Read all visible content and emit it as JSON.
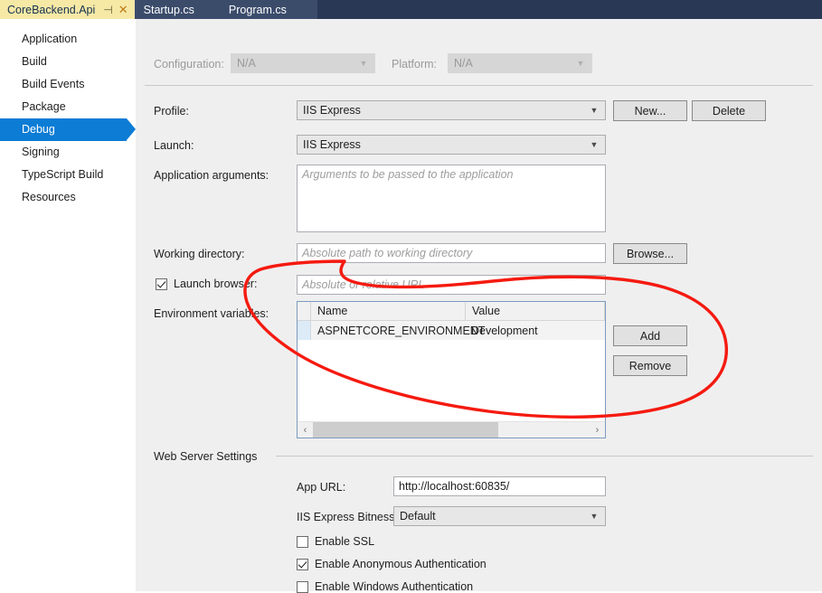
{
  "window": {
    "tabs": [
      {
        "label": "CoreBackend.Api",
        "active": true,
        "pin_icon": "pin-icon",
        "close_icon": "close-icon"
      },
      {
        "label": "Startup.cs",
        "active": false
      },
      {
        "label": "Program.cs",
        "active": false
      }
    ]
  },
  "sidebar": {
    "items": [
      {
        "label": "Application",
        "selected": false
      },
      {
        "label": "Build",
        "selected": false
      },
      {
        "label": "Build Events",
        "selected": false
      },
      {
        "label": "Package",
        "selected": false
      },
      {
        "label": "Debug",
        "selected": true
      },
      {
        "label": "Signing",
        "selected": false
      },
      {
        "label": "TypeScript Build",
        "selected": false
      },
      {
        "label": "Resources",
        "selected": false
      }
    ]
  },
  "config_row": {
    "configuration_label": "Configuration:",
    "configuration_value": "N/A",
    "platform_label": "Platform:",
    "platform_value": "N/A"
  },
  "debug": {
    "profile_label": "Profile:",
    "profile_value": "IIS Express",
    "new_button": "New...",
    "delete_button": "Delete",
    "launch_label": "Launch:",
    "launch_value": "IIS Express",
    "app_args_label": "Application arguments:",
    "app_args_placeholder": "Arguments to be passed to the application",
    "working_dir_label": "Working directory:",
    "working_dir_placeholder": "Absolute path to working directory",
    "browse_button": "Browse...",
    "launch_browser_label": "Launch browser:",
    "launch_browser_checked": true,
    "launch_browser_placeholder": "Absolute or relative URL",
    "env_vars_label": "Environment variables:",
    "env_grid": {
      "columns": [
        "Name",
        "Value"
      ],
      "rows": [
        {
          "name": "ASPNETCORE_ENVIRONMENT",
          "value": "Development"
        }
      ],
      "scroll_left_icon": "chevron-left-icon",
      "scroll_right_icon": "chevron-right-icon"
    },
    "add_button": "Add",
    "remove_button": "Remove"
  },
  "web_server": {
    "section_title": "Web Server Settings",
    "app_url_label": "App URL:",
    "app_url_value": "http://localhost:60835/",
    "bitness_label": "IIS Express Bitness:",
    "bitness_value": "Default",
    "checkboxes": [
      {
        "label": "Enable SSL",
        "checked": false
      },
      {
        "label": "Enable Anonymous Authentication",
        "checked": true
      },
      {
        "label": "Enable Windows Authentication",
        "checked": false
      }
    ]
  },
  "annotation": {
    "shape": "hand-drawn-ellipse",
    "color": "#F51A10"
  }
}
